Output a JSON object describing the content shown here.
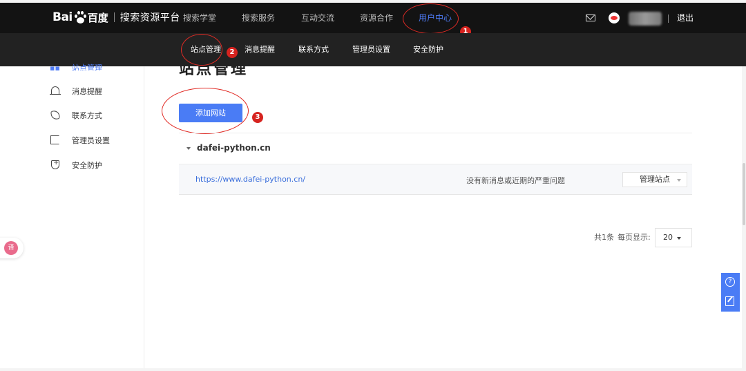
{
  "header": {
    "logo_latin": "Bai",
    "logo_cn": "百度",
    "platform": "搜索资源平台",
    "nav": [
      {
        "label": "搜索学堂",
        "active": false
      },
      {
        "label": "搜索服务",
        "active": false
      },
      {
        "label": "互动交流",
        "active": false
      },
      {
        "label": "资源合作",
        "active": false
      },
      {
        "label": "用户中心",
        "active": true
      }
    ],
    "logout": "退出",
    "accent_color": "#4e7bf5"
  },
  "subnav": {
    "items": [
      "站点管理",
      "消息提醒",
      "联系方式",
      "管理员设置",
      "安全防护"
    ]
  },
  "annotations": [
    "1",
    "2",
    "3"
  ],
  "sidebar": {
    "items": [
      {
        "label": "站点管理",
        "icon": "grid-icon"
      },
      {
        "label": "消息提醒",
        "icon": "bell-icon"
      },
      {
        "label": "联系方式",
        "icon": "phone-icon"
      },
      {
        "label": "管理员设置",
        "icon": "admin-icon"
      },
      {
        "label": "安全防护",
        "icon": "shield-icon"
      }
    ]
  },
  "main": {
    "title": "站点管理",
    "add_button": "添加网站",
    "domain": "dafei-python.cn",
    "site": {
      "url": "https://www.dafei-python.cn/",
      "status": "没有新消息或近期的严重问题",
      "manage": "管理站点"
    },
    "pagination": {
      "total": "共1条",
      "per_page_label": "每页显示:",
      "per_page": "20"
    }
  },
  "widgets": {
    "help": "?",
    "translate": "译"
  }
}
